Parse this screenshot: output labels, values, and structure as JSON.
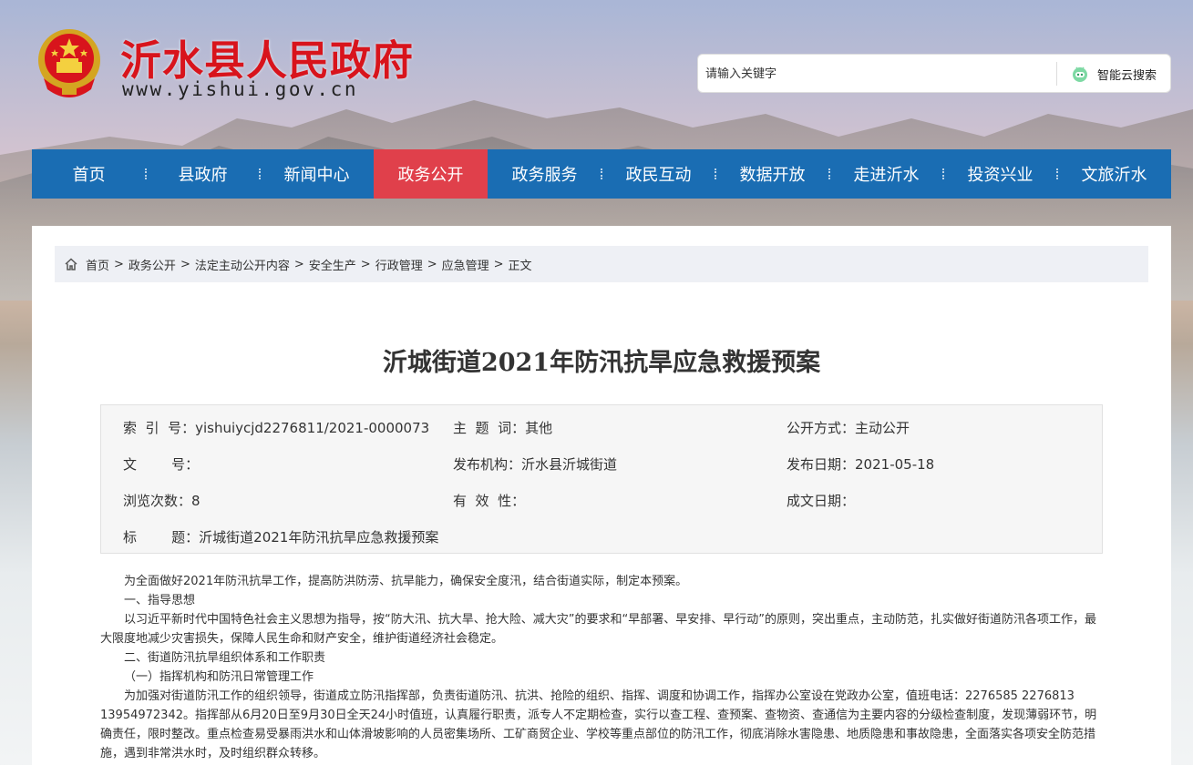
{
  "site": {
    "name": "沂水县人民政府",
    "url": "www.yishui.gov.cn"
  },
  "search": {
    "placeholder": "请输入关键字",
    "button_label": "智能云搜索"
  },
  "nav": {
    "items": [
      {
        "label": "首页"
      },
      {
        "label": "县政府"
      },
      {
        "label": "新闻中心"
      },
      {
        "label": "政务公开",
        "active": true
      },
      {
        "label": "政务服务"
      },
      {
        "label": "政民互动"
      },
      {
        "label": "数据开放"
      },
      {
        "label": "走进沂水"
      },
      {
        "label": "投资兴业"
      },
      {
        "label": "文旅沂水"
      }
    ]
  },
  "breadcrumb": {
    "items": [
      "首页",
      "政务公开",
      "法定主动公开内容",
      "安全生产",
      "行政管理",
      "应急管理",
      "正文"
    ],
    "separator": ">"
  },
  "article": {
    "title": "沂城街道2021年防汛抗旱应急救援预案",
    "meta": {
      "index_label": "索  引  号：",
      "index_value": "yishuiycjd2276811/2021-0000073",
      "subject_label": "主  题  词：",
      "subject_value": "其他",
      "mode_label": "公开方式：",
      "mode_value": "主动公开",
      "doc_no_label": "文        号：",
      "doc_no_value": "",
      "publisher_label": "发布机构：",
      "publisher_value": "沂水县沂城街道",
      "date_label": "发布日期：",
      "date_value": "2021-05-18",
      "views_label": "浏览次数：",
      "views_value": "8",
      "validity_label": "有  效  性：",
      "validity_value": "",
      "created_label": "成文日期：",
      "created_value": "",
      "title_label": "标        题：",
      "title_value": "沂城街道2021年防汛抗旱应急救援预案"
    },
    "paragraphs": [
      "为全面做好2021年防汛抗旱工作，提高防洪防涝、抗旱能力，确保安全度汛，结合街道实际，制定本预案。",
      "一、指导思想",
      "以习近平新时代中国特色社会主义思想为指导，按“防大汛、抗大旱、抢大险、减大灾”的要求和“早部署、早安排、早行动”的原则，突出重点，主动防范，扎实做好街道防汛各项工作，最大限度地减少灾害损失，保障人民生命和财产安全，维护街道经济社会稳定。",
      "二、街道防汛抗旱组织体系和工作职责",
      "（一）指挥机构和防汛日常管理工作",
      "为加强对街道防汛工作的组织领导，街道成立防汛指挥部，负责街道防汛、抗洪、抢险的组织、指挥、调度和协调工作，指挥办公室设在党政办公室，值班电话：2276585 2276813 13954972342。指挥部从6月20日至9月30日全天24小时值班，认真履行职责，派专人不定期检查，实行以查工程、查预案、查物资、查通信为主要内容的分级检查制度，发现薄弱环节，明确责任，限时整改。重点检查易受暴雨洪水和山体滑坡影响的人员密集场所、工矿商贸企业、学校等重点部位的防汛工作，彻底消除水害隐患、地质隐患和事故隐患，全面落实各项安全防范措施，遇到非常洪水时，及时组织群众转移。"
    ]
  },
  "colors": {
    "brand_red": "#d8141c",
    "nav_blue": "#1a6db3",
    "nav_active": "#e0404b"
  },
  "icons": [
    "national-emblem-icon",
    "robot-icon",
    "home-icon"
  ]
}
